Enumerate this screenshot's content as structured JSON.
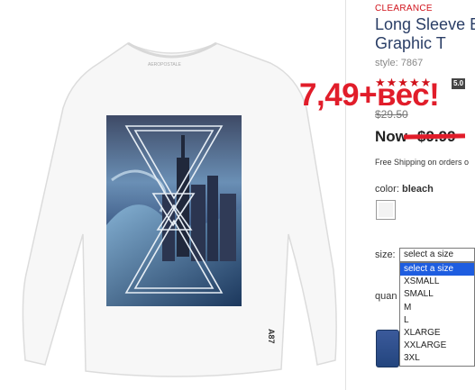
{
  "product": {
    "clearance_label": "CLEARANCE",
    "title_line1": "Long Sleeve Er",
    "title_line2": "Graphic T",
    "style_number": "style: 7867",
    "rating_stars": "★★★★★",
    "rating_value": "5.0",
    "old_price": "$29.50",
    "now_label": "Now",
    "now_price": "$9.99",
    "free_shipping": "Free Shipping on orders o"
  },
  "overlay": {
    "text": "7,49+вес!",
    "color": "#e11d2a"
  },
  "color_picker": {
    "label": "color:",
    "value": "bleach"
  },
  "size_picker": {
    "label": "size:",
    "selected": "select a size",
    "options": [
      "select a size",
      "XSMALL",
      "SMALL",
      "M",
      "L",
      "XLARGE",
      "XXLARGE",
      "3XL"
    ]
  },
  "quantity": {
    "label": "quan"
  },
  "image": {
    "tag_text": "AEROPOSTALE",
    "sleeve_mark": "A87"
  }
}
